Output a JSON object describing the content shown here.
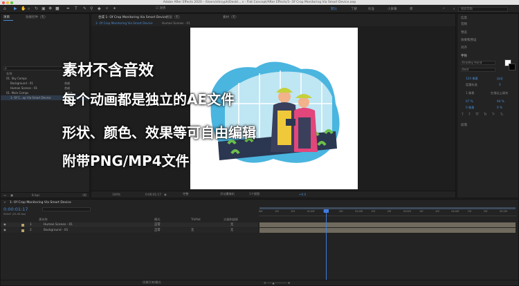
{
  "window": {
    "title": "Adobe After Effects 2020 - /Users/shinyph/Deskt... s - Flat Concept/After Effects/1- Of Crop Monitoring Via Smart Device.aep"
  },
  "workspaces": [
    "默认",
    "了解",
    "标准",
    "小屏幕",
    "库"
  ],
  "search": {
    "placeholder": "搜索帮助"
  },
  "left_panel": {
    "tabs": [
      "项目",
      "效果控件（无）"
    ],
    "search_placeholder": "ρ",
    "column_name": "名称",
    "items": [
      {
        "name": "01. Sky Comps",
        "type": ""
      },
      {
        "name": "Background - 01",
        "type": "合成"
      },
      {
        "name": "Human Scenes - 01",
        "type": "合成"
      },
      {
        "name": "01. Main Comps",
        "type": "文件夹"
      },
      {
        "name": "1- Of C...op Via Smart Device",
        "type": "合成"
      }
    ],
    "bpc": "8 bpc"
  },
  "comp_panel": {
    "tab": "合成 1- Of Crop Monitoring Via Smart Device",
    "layer_tab": "图层（无）",
    "footage_tab": "素材（无）",
    "subtabs": [
      "1- Of Crop Monitoring Via Smart Device",
      "Human Scenes - 01"
    ],
    "zoom": "100%",
    "timecode": "0:00:01:17",
    "quality": "完整",
    "camera": "活动摄像机",
    "views": "1个视图",
    "offset": "+0.0"
  },
  "right_panel": {
    "items": [
      "信息",
      "音频",
      "预览",
      "效果和预设",
      "对齐",
      "字符"
    ],
    "font_name": "Bradley Hand",
    "font_style": "Bold",
    "size": "124 像素",
    "leading": "自动",
    "kerning": "度量标准",
    "tracking": "0",
    "stroke": "1 像素",
    "stroke_mode": "在描边上填充",
    "vscale": "67 %",
    "hscale": "94 %",
    "baseline": "0 像素",
    "tsume": "0 %",
    "paragraph": "段落"
  },
  "overlay": {
    "lines": [
      "素材不含音效",
      "每个动画都是独立的AE文件",
      "形状、颜色、效果等可自由编辑",
      "附带PNG/MP4文件"
    ]
  },
  "timeline": {
    "comp_tab": "1- Of Crop Monitoring Via Smart Device",
    "timecode": "0:00:01:17",
    "sub_timecode": "00047 (25.00 fps)",
    "headers": {
      "source": "源名称",
      "mode": "模式",
      "trkmat": "TrkMat",
      "parent": "父级和链接"
    },
    "layers": [
      {
        "index": "1",
        "name": "Human Scenes - 01",
        "mode": "正常",
        "trkmat": "",
        "parent": "无"
      },
      {
        "index": "2",
        "name": "Background - 01",
        "mode": "正常",
        "trkmat": "无",
        "parent": "无"
      }
    ],
    "ruler": [
      "00f",
      "10f",
      "20f",
      "01:00f",
      "10f",
      "20f",
      "02:00f",
      "10f",
      "20f",
      "03:00f",
      "10f",
      "20f",
      "04:00f",
      "10f",
      "20f",
      "05:00f"
    ],
    "footer": "切换开关/模式"
  },
  "colors": {
    "accent": "#4b8ed6",
    "playhead": "#3d7de0",
    "layer_bar": "#6f6a5d"
  }
}
